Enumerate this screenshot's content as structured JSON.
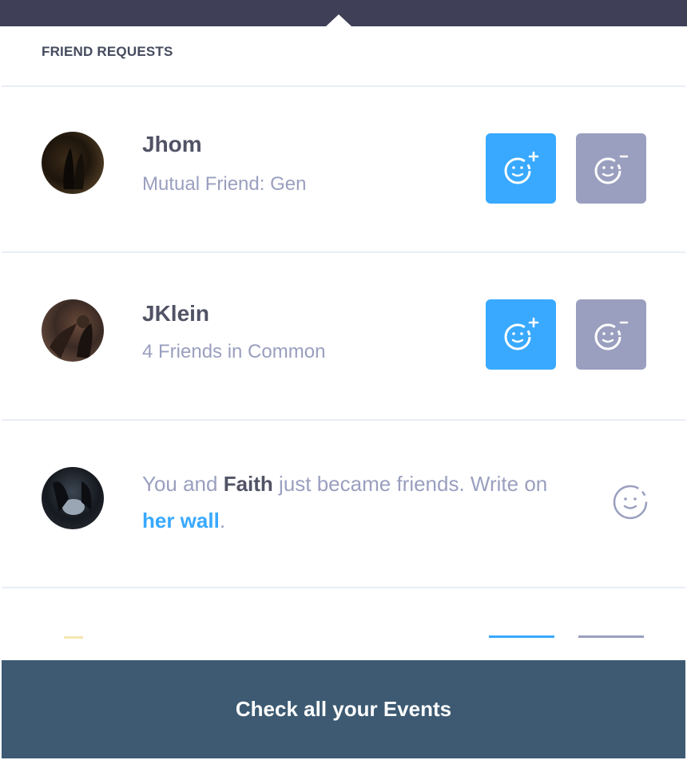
{
  "header": {
    "title": "FRIEND REQUESTS"
  },
  "requests": [
    {
      "name": "Jhom",
      "detail": "Mutual Friend: Gen"
    },
    {
      "name": "JKlein",
      "detail": "4 Friends in Common"
    }
  ],
  "notification": {
    "prefix": "You and ",
    "friend_name": "Faith",
    "middle": " just became friends. Write on ",
    "link_text": "her wall",
    "suffix": "."
  },
  "footer": {
    "label": "Check all your Events"
  },
  "icons": {
    "accept": "add-friend-icon",
    "decline": "remove-friend-icon",
    "notification": "smiley-icon"
  },
  "colors": {
    "accent": "#38a9ff",
    "decline": "#9a9fbf",
    "topbar": "#3f3f57",
    "footer": "#3d5a72"
  }
}
